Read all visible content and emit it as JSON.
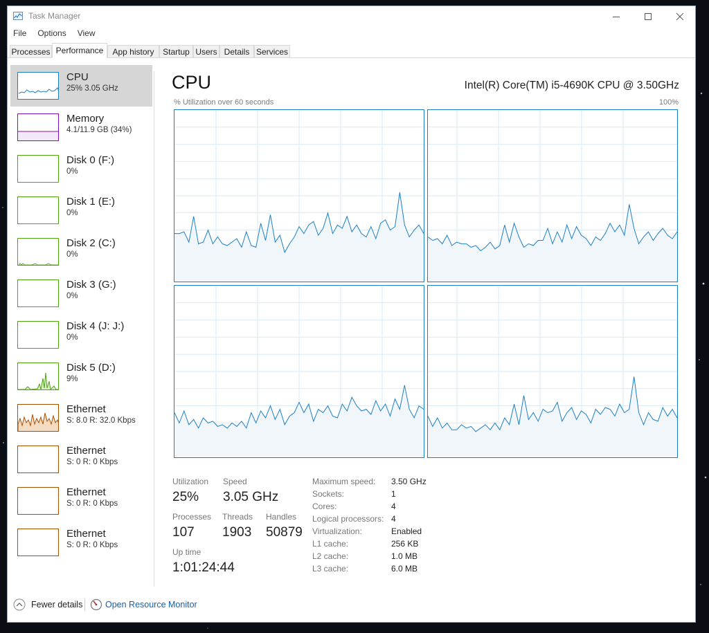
{
  "window": {
    "title": "Task Manager"
  },
  "menu": [
    "File",
    "Options",
    "View"
  ],
  "tabs": [
    "Processes",
    "Performance",
    "App history",
    "Startup",
    "Users",
    "Details",
    "Services"
  ],
  "sidebar": [
    {
      "title": "CPU",
      "sub": "25%  3.05 GHz",
      "color": "#1b7fc4"
    },
    {
      "title": "Memory",
      "sub": "4.1/11.9 GB (34%)",
      "color": "#8b12ae"
    },
    {
      "title": "Disk 0 (F:)",
      "sub": "0%",
      "color": "#4da60c"
    },
    {
      "title": "Disk 1 (E:)",
      "sub": "0%",
      "color": "#4da60c"
    },
    {
      "title": "Disk 2 (C:)",
      "sub": "0%",
      "color": "#4da60c"
    },
    {
      "title": "Disk 3 (G:)",
      "sub": "0%",
      "color": "#4da60c"
    },
    {
      "title": "Disk 4 (J: J:)",
      "sub": "0%",
      "color": "#4da60c"
    },
    {
      "title": "Disk 5 (D:)",
      "sub": "9%",
      "color": "#4da60c"
    },
    {
      "title": "Ethernet",
      "sub": "S: 8.0  R: 32.0 Kbps",
      "color": "#a74f01"
    },
    {
      "title": "Ethernet",
      "sub": "S: 0  R: 0 Kbps",
      "color": "#a74f01"
    },
    {
      "title": "Ethernet",
      "sub": "S: 0  R: 0 Kbps",
      "color": "#a74f01"
    },
    {
      "title": "Ethernet",
      "sub": "S: 0  R: 0 Kbps",
      "color": "#a74f01"
    }
  ],
  "main": {
    "title": "CPU",
    "cpu_name": "Intel(R) Core(TM) i5-4690K CPU @ 3.50GHz",
    "graph_caption": "% Utilization over 60 seconds",
    "graph_max": "100%"
  },
  "stats": {
    "utilization_label": "Utilization",
    "utilization": "25%",
    "speed_label": "Speed",
    "speed": "3.05 GHz",
    "processes_label": "Processes",
    "processes": "107",
    "threads_label": "Threads",
    "threads": "1903",
    "handles_label": "Handles",
    "handles": "50879",
    "uptime_label": "Up time",
    "uptime": "1:01:24:44"
  },
  "info": [
    {
      "k": "Maximum speed:",
      "v": "3.50 GHz"
    },
    {
      "k": "Sockets:",
      "v": "1"
    },
    {
      "k": "Cores:",
      "v": "4"
    },
    {
      "k": "Logical processors:",
      "v": "4"
    },
    {
      "k": "Virtualization:",
      "v": "Enabled"
    },
    {
      "k": "L1 cache:",
      "v": "256 KB"
    },
    {
      "k": "L2 cache:",
      "v": "1.0 MB"
    },
    {
      "k": "L3 cache:",
      "v": "6.0 MB"
    }
  ],
  "footer": {
    "fewer_details": "Fewer details",
    "resource_monitor": "Open Resource Monitor"
  },
  "colors": {
    "cpu": "#1b7fc4",
    "grid": "#d9eaf7",
    "fill": "#f1f6fb",
    "link": "#1060b0"
  },
  "chart_data": [
    {
      "type": "area",
      "ylim": [
        0,
        100
      ],
      "values": [
        28,
        28,
        29,
        23,
        38,
        22,
        23,
        30,
        22,
        26,
        22,
        21,
        23,
        25,
        20,
        29,
        21,
        20,
        34,
        24,
        39,
        23,
        27,
        17,
        22,
        26,
        32,
        28,
        33,
        35,
        27,
        31,
        40,
        28,
        33,
        31,
        38,
        29,
        33,
        28,
        26,
        32,
        25,
        34,
        36,
        30,
        32,
        52,
        33,
        26,
        30,
        33,
        28
      ]
    },
    {
      "type": "area",
      "ylim": [
        0,
        100
      ],
      "values": [
        26,
        24,
        25,
        22,
        27,
        21,
        23,
        22,
        22,
        20,
        21,
        18,
        20,
        23,
        19,
        21,
        33,
        23,
        34,
        26,
        20,
        22,
        21,
        24,
        24,
        31,
        22,
        29,
        23,
        33,
        25,
        32,
        27,
        25,
        21,
        26,
        24,
        28,
        34,
        29,
        33,
        27,
        45,
        31,
        22,
        26,
        29,
        24,
        28,
        31,
        27,
        25,
        29
      ]
    },
    {
      "type": "area",
      "ylim": [
        0,
        100
      ],
      "values": [
        26,
        20,
        27,
        19,
        22,
        17,
        23,
        20,
        21,
        18,
        19,
        17,
        20,
        18,
        21,
        17,
        26,
        20,
        27,
        23,
        30,
        22,
        28,
        19,
        24,
        26,
        32,
        26,
        31,
        21,
        28,
        26,
        30,
        24,
        23,
        31,
        27,
        35,
        30,
        27,
        28,
        25,
        33,
        27,
        31,
        24,
        34,
        28,
        42,
        28,
        23,
        30,
        28
      ]
    },
    {
      "type": "area",
      "ylim": [
        0,
        100
      ],
      "values": [
        24,
        18,
        23,
        17,
        20,
        16,
        16,
        19,
        17,
        18,
        15,
        17,
        19,
        16,
        20,
        16,
        23,
        19,
        31,
        19,
        36,
        22,
        26,
        21,
        28,
        26,
        27,
        32,
        21,
        26,
        29,
        22,
        27,
        25,
        20,
        28,
        25,
        29,
        28,
        24,
        31,
        26,
        28,
        47,
        26,
        19,
        26,
        22,
        21,
        29,
        24,
        28,
        23
      ]
    }
  ]
}
